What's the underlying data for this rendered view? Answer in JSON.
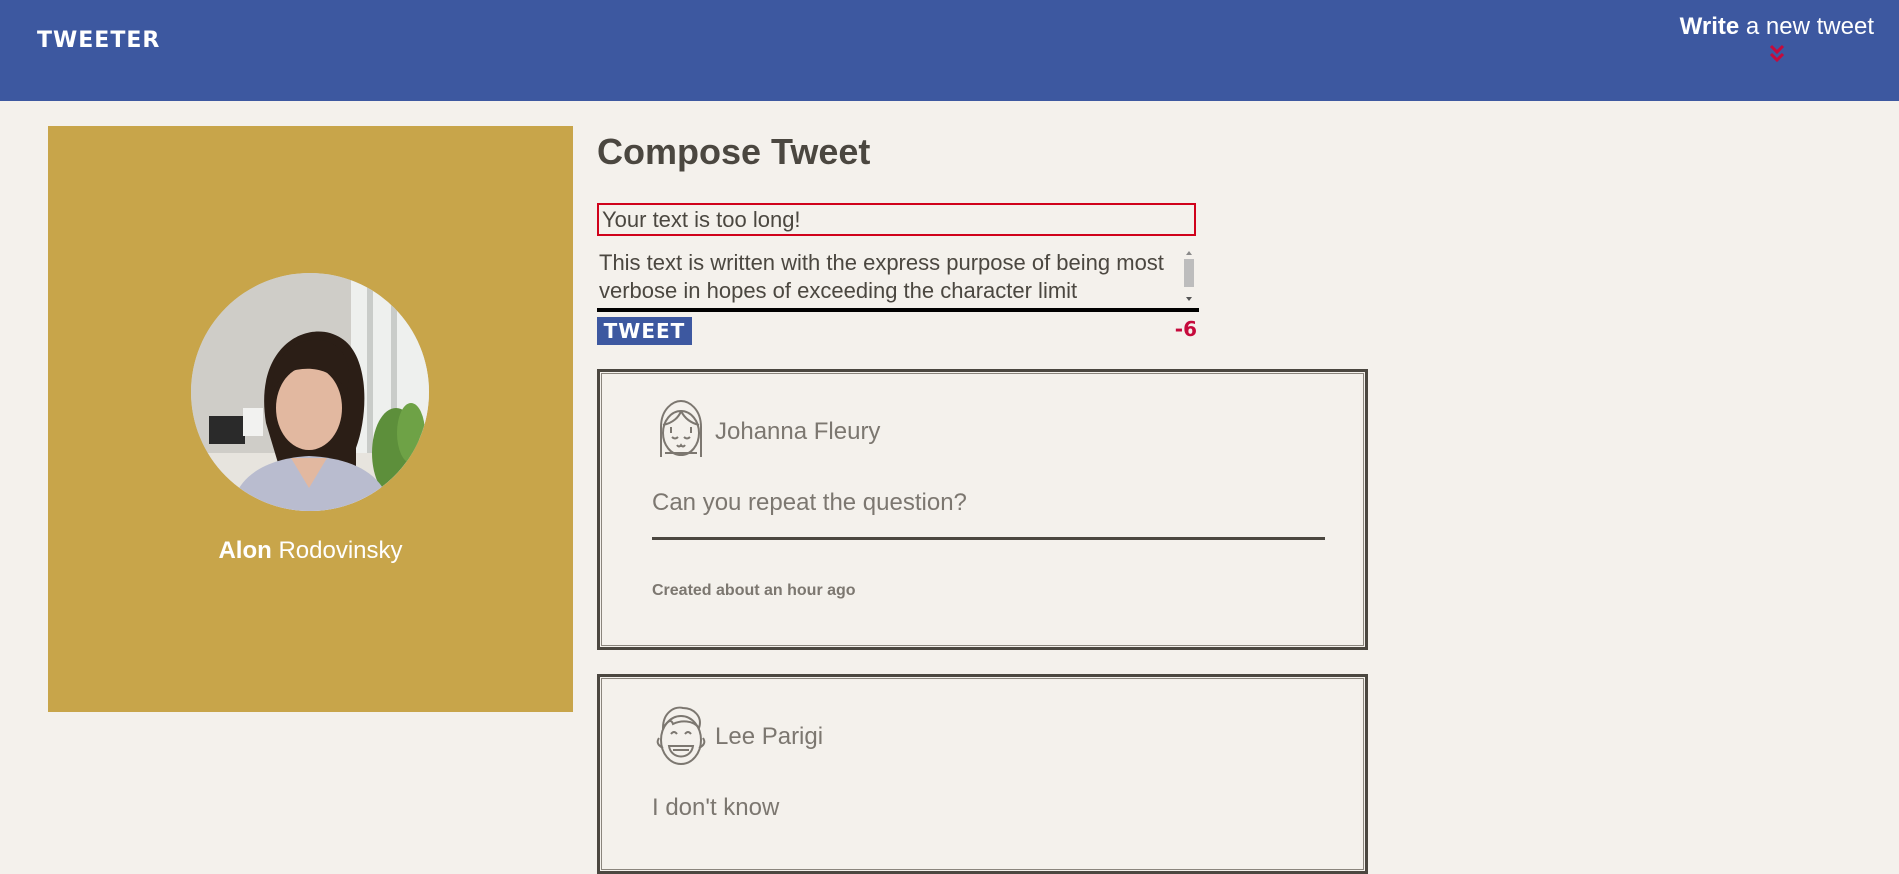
{
  "nav": {
    "brand": "TWEETER",
    "write_bold": "Write",
    "write_rest": " a new tweet",
    "chevron_icon": "double-chevron-down-icon",
    "chevron_color": "#c60a3c",
    "background": "#3d58a0"
  },
  "profile": {
    "first_name": "Alon",
    "last_name": " Rodovinsky",
    "background": "#c8a54a"
  },
  "compose": {
    "title": "Compose Tweet",
    "error": "Your text is too long!",
    "text_value": "This text is written with the express purpose of being most verbose in hopes of exceeding the character limit",
    "button_label": "TWEET",
    "counter": "-6",
    "error_color": "#d0021b"
  },
  "tweets": [
    {
      "user": "Johanna Fleury",
      "avatar_icon": "girl-avatar-icon",
      "text": "Can you repeat the question?",
      "created": "Created about an hour ago"
    },
    {
      "user": "Lee Parigi",
      "avatar_icon": "laughing-boy-avatar-icon",
      "text": "I don't know"
    }
  ]
}
